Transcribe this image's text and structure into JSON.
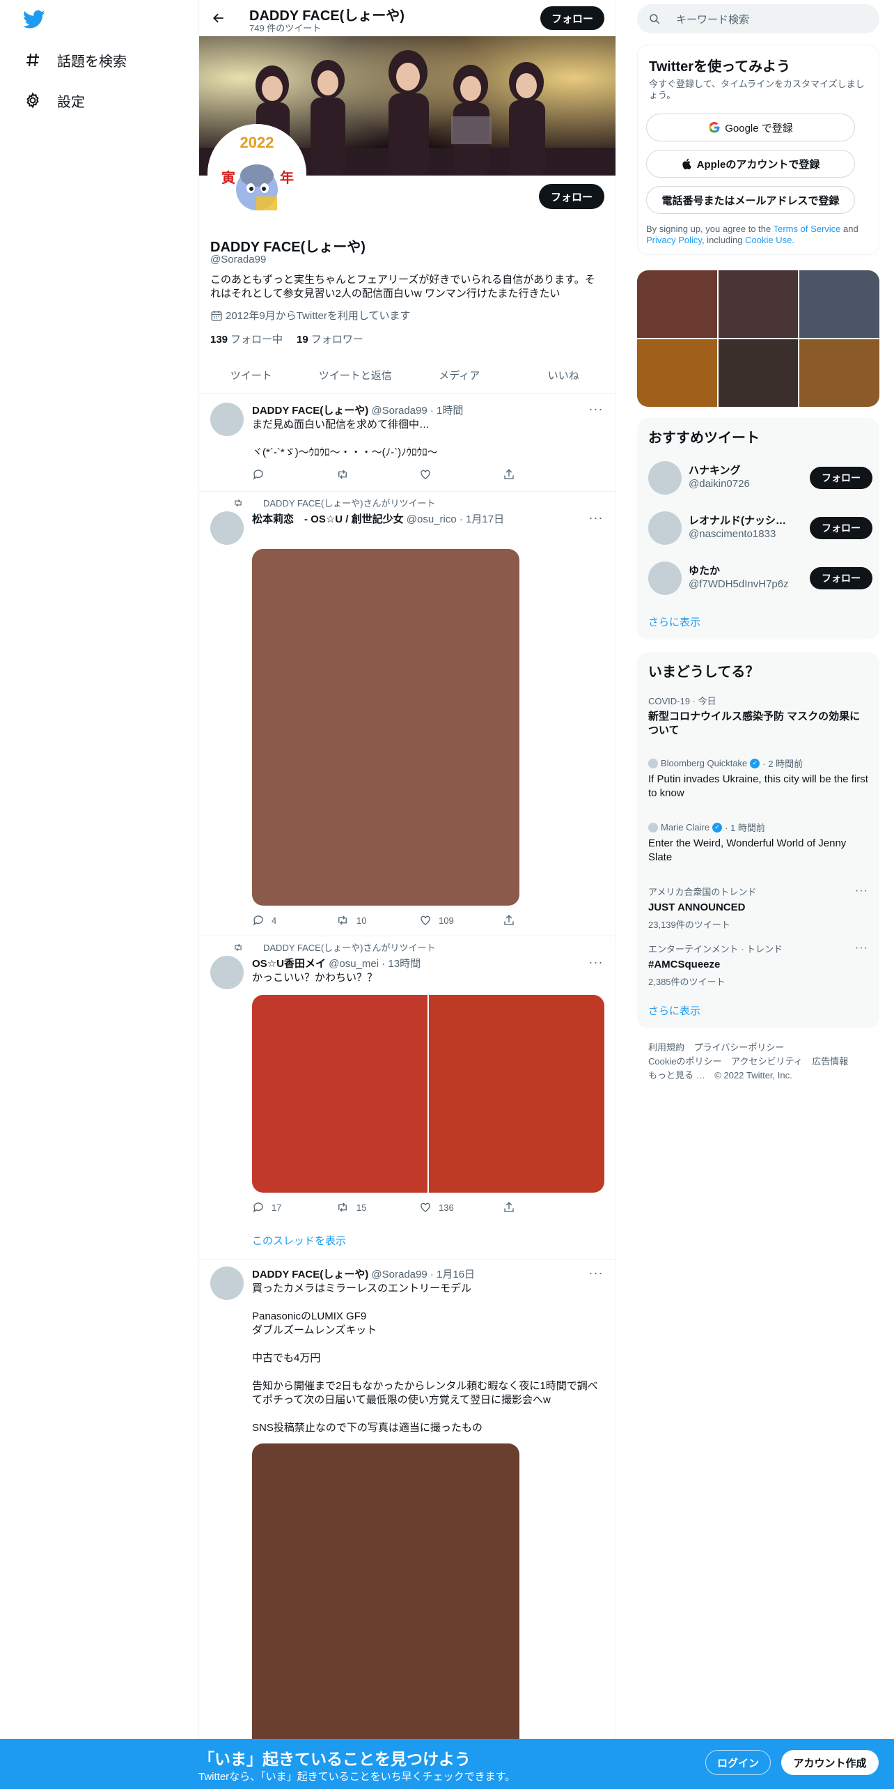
{
  "nav": {
    "explore_label": "話題を検索",
    "settings_label": "設定"
  },
  "profile": {
    "title": "DADDY FACE(しょーや)",
    "tweet_count": "749 件のツイート",
    "follow_label": "フォロー",
    "name": "DADDY FACE(しょーや)",
    "handle": "@Sorada99",
    "bio": "このあともずっと実生ちゃんとフェアリーズが好きでいられる自信があります。それはそれとして参女見習い2人の配信面白いw ワンマン行けたまた行きたい",
    "joined": "2012年9月からTwitterを利用しています",
    "following_count": "139",
    "following_label": "フォロー中",
    "followers_count": "19",
    "followers_label": "フォロワー",
    "avatar_text": {
      "top": "2022",
      "left": "寅",
      "right": "年"
    }
  },
  "tabs": [
    "ツイート",
    "ツイートと返信",
    "メディア",
    "いいね"
  ],
  "tweets": [
    {
      "name": "DADDY FACE(しょーや)",
      "meta": "@Sorada99 · 1時間",
      "text": "まだ見ぬ面白い配信を求めて徘徊中…\n\nヾ(*´-`*ゞ)～ｳﾛｳﾛ～・・・～(ﾉ-`)ﾉｳﾛｳﾛ～",
      "image_color": "",
      "replies": "",
      "retweets": "",
      "likes": ""
    },
    {
      "retweeted_by": "DADDY FACE(しょーや)さんがリツイート",
      "name": "松本莉恋　- OS☆U / 創世記少女",
      "meta": "@osu_rico · 1月17日",
      "text": "",
      "image_color": "#8b5a4a",
      "replies": "4",
      "retweets": "10",
      "likes": "109"
    },
    {
      "retweeted_by": "DADDY FACE(しょーや)さんがリツイート",
      "name": "OS☆U香田メイ",
      "meta": "@osu_mei · 13時間",
      "text": "かっこいい？かわちい？？",
      "image_colors": [
        "#c0392b",
        "#bf3a24"
      ],
      "replies": "17",
      "retweets": "15",
      "likes": "136",
      "thread_link": "このスレッドを表示"
    },
    {
      "name": "DADDY FACE(しょーや)",
      "meta": "@Sorada99 · 1月16日",
      "text": "買ったカメラはミラーレスのエントリーモデル\n\nPanasonicのLUMIX GF9\nダブルズームレンズキット\n\n中古でも4万円\n\n告知から開催まで2日もなかったからレンタル頼む暇なく夜に1時間で調べてポチって次の日届いて最低限の使い方覚えて翌日に撮影会へw\n\nSNS投稿禁止なので下の写真は適当に撮ったもの",
      "image_color": "#6b3f30"
    }
  ],
  "right": {
    "search_placeholder": "キーワード検索",
    "signup": {
      "title": "Twitterを使ってみよう",
      "subtitle": "今すぐ登録して、タイムラインをカスタマイズしましょう。",
      "google": "Google で登録",
      "apple": "Appleのアカウントで登録",
      "phone": "電話番号またはメールアドレスで登録",
      "terms_pre": "By signing up, you agree to the ",
      "terms_link": "Terms of Service",
      "terms_and": " and ",
      "privacy_link": "Privacy Policy",
      "terms_incl": ", including ",
      "cookie_link": "Cookie Use."
    },
    "media_colors": [
      "#6b3a2e",
      "#4a3536",
      "#4c5566",
      "#a0601c",
      "#3a2f2a",
      "#8a5a28"
    ],
    "recommended": {
      "title": "おすすめツイート",
      "users": [
        {
          "name": "ハナキング",
          "handle": "@daikin0726"
        },
        {
          "name": "レオナルド(ナッシー…",
          "handle": "@nascimento1833"
        },
        {
          "name": "ゆたか",
          "handle": "@f7WDH5dInvH7p6z"
        }
      ],
      "follow_label": "フォロー",
      "more": "さらに表示"
    },
    "trends": {
      "title": "いまどうしてる？",
      "items": [
        {
          "meta": "COVID-19 · 今日",
          "title": "新型コロナウイルス感染予防 マスクの効果について"
        },
        {
          "meta": "Bloomberg Quicktake",
          "time": "· 2 時間前",
          "title": "If Putin invades Ukraine, this city will be the first to know"
        },
        {
          "meta": "Marie Claire",
          "time": "· 1 時間前",
          "title": "Enter the Weird, Wonderful World of Jenny Slate"
        },
        {
          "meta": "アメリカ合衆国のトレンド",
          "title": "JUST ANNOUNCED",
          "count": "23,139件のツイート"
        },
        {
          "meta": "エンターテインメント · トレンド",
          "title": "#AMCSqueeze",
          "count": "2,385件のツイート"
        }
      ],
      "more": "さらに表示"
    },
    "footer": {
      "terms": "利用規約",
      "privacy": "プライバシーポリシー",
      "cookie": "Cookieのポリシー",
      "access": "アクセシビリティ",
      "ads": "広告情報",
      "more": "もっと見る …",
      "copy": "© 2022 Twitter, Inc."
    }
  },
  "bottom": {
    "title": "「いま」起きていることを見つけよう",
    "subtitle": "Twitterなら、「いま」起きていることをいち早くチェックできます。",
    "login": "ログイン",
    "signup": "アカウント作成"
  },
  "colors": {
    "accent": "#1d9bf0",
    "text": "#0f1419",
    "muted": "#536471"
  }
}
